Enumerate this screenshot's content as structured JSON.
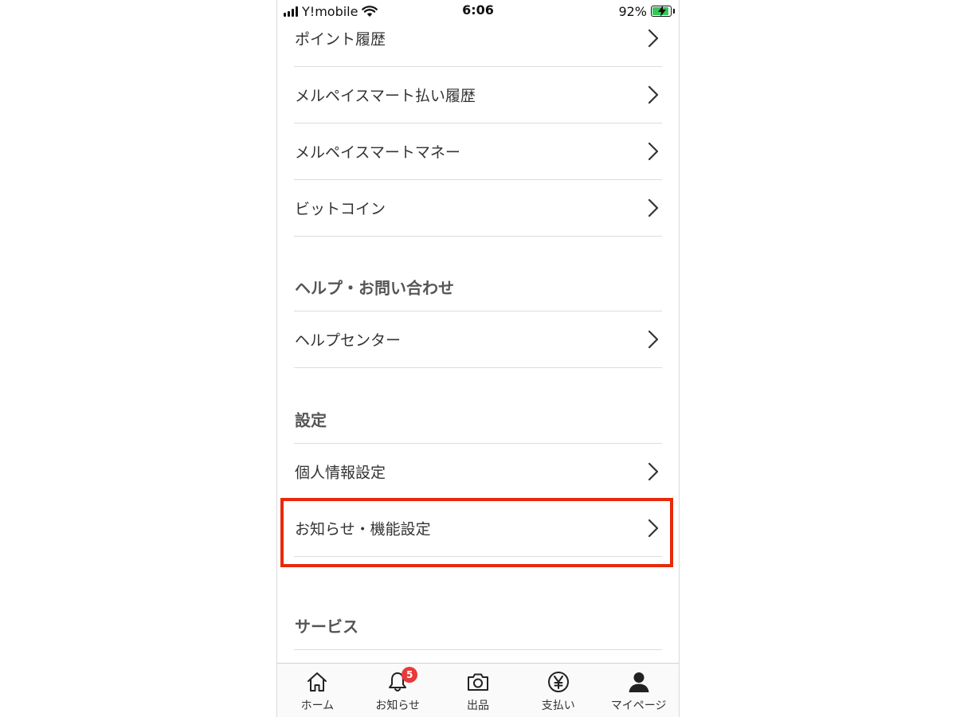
{
  "status_bar": {
    "carrier": "Y!mobile",
    "time": "6:06",
    "battery_percent": "92%",
    "battery_level": 0.92,
    "icons": [
      "signal-icon",
      "wifi-icon",
      "battery-charging-icon"
    ]
  },
  "menu": {
    "items": [
      {
        "label": "ポイント履歴"
      },
      {
        "label": "メルペイスマート払い履歴"
      },
      {
        "label": "メルペイスマートマネー"
      },
      {
        "label": "ビットコイン"
      }
    ],
    "help_section": {
      "title": "ヘルプ・お問い合わせ",
      "items": [
        {
          "label": "ヘルプセンター"
        }
      ]
    },
    "settings_section": {
      "title": "設定",
      "items": [
        {
          "label": "個人情報設定"
        },
        {
          "label": "お知らせ・機能設定"
        }
      ]
    },
    "service_section": {
      "title": "サービス"
    }
  },
  "tab_bar": {
    "tabs": [
      {
        "label": "ホーム",
        "icon": "home-icon"
      },
      {
        "label": "お知らせ",
        "icon": "bell-icon",
        "badge": "5"
      },
      {
        "label": "出品",
        "icon": "camera-icon"
      },
      {
        "label": "支払い",
        "icon": "yen-icon"
      },
      {
        "label": "マイページ",
        "icon": "person-icon"
      }
    ]
  },
  "colors": {
    "highlight": "#e8290b",
    "badge": "#e83a3a",
    "battery": "#34c759"
  }
}
